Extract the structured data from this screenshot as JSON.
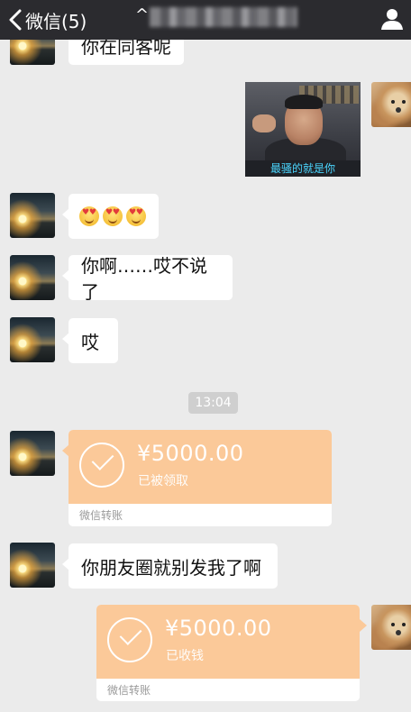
{
  "header": {
    "back_label": "微信(5)",
    "caret": "^"
  },
  "messages": {
    "partial_text": "你在同客呢",
    "sticker_caption": "最骚的就是你",
    "text_1": "你啊……哎不说了",
    "text_2": "哎",
    "text_3": "你朋友圈就别发我了啊"
  },
  "timestamp": "13:04",
  "transfers": [
    {
      "amount": "¥5000.00",
      "status": "已被领取",
      "footer": "微信转账"
    },
    {
      "amount": "¥5000.00",
      "status": "已收钱",
      "footer": "微信转账"
    }
  ],
  "colors": {
    "topbar": "#2b2b2f",
    "background": "#ebebeb",
    "transfer": "#fbc999"
  },
  "icons": [
    "back-chevron-icon",
    "profile-icon",
    "check-circle-icon",
    "heart-eyes-emoji-icon"
  ]
}
